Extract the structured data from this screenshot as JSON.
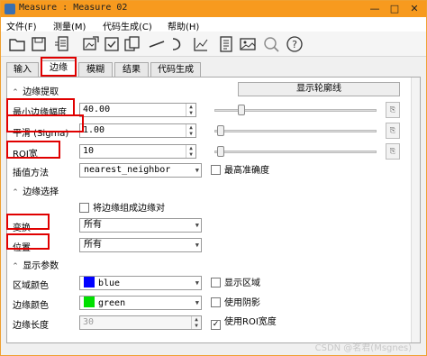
{
  "window": {
    "title": "Measure : Measure 02",
    "minimize": "—",
    "maximize": "□",
    "close": "✕"
  },
  "menu": [
    "文件(F)",
    "测量(M)",
    "代码生成(C)",
    "帮助(H)"
  ],
  "toolbar_icons": [
    "folder-open-icon",
    "save-icon",
    "document-list-icon",
    "image-measure-icon",
    "checklist-icon",
    "copy-icon",
    "line-icon",
    "arc-icon",
    "chart-icon",
    "report-icon",
    "image-icon",
    "zoom-region-icon",
    "help-icon"
  ],
  "tabs": {
    "items": [
      "输入",
      "边缘",
      "模糊",
      "结果",
      "代码生成"
    ],
    "active": 1
  },
  "edge_extraction": {
    "header": "边缘提取",
    "show_contour_button": "显示轮廓线",
    "min_amplitude": {
      "label": "最小边缘幅度",
      "value": "40.00",
      "slider_fraction": 0.15
    },
    "smoothing": {
      "label": "平滑 (Sigma)",
      "value": "1.00",
      "slider_fraction": 0.02
    },
    "roi_width": {
      "label": "ROI宽",
      "value": "10",
      "slider_fraction": 0.02
    },
    "interpolation": {
      "label": "插值方法",
      "value": "nearest_neighbor",
      "max_precision_label": "最高准确度"
    }
  },
  "edge_selection": {
    "header": "边缘选择",
    "group_edges_label": "将边缘组成边缘对",
    "transition": {
      "label": "变换",
      "value": "所有"
    },
    "position": {
      "label": "位置",
      "value": "所有"
    }
  },
  "display_params": {
    "header": "显示参数",
    "region_color": {
      "label": "区域颜色",
      "value": "blue",
      "swatch": "#0000ff",
      "check_label": "显示区域"
    },
    "edge_color": {
      "label": "边缘颜色",
      "value": "green",
      "swatch": "#00e000",
      "check_label": "使用阴影"
    },
    "edge_length": {
      "label": "边缘长度",
      "value": "30",
      "check_label": "使用ROI宽度",
      "checked": true
    }
  },
  "watermark": "CSDN @茗君(Msgnes)",
  "accent_colors": {
    "titlebar": "#f79a1e",
    "annotation": "#e00000"
  }
}
